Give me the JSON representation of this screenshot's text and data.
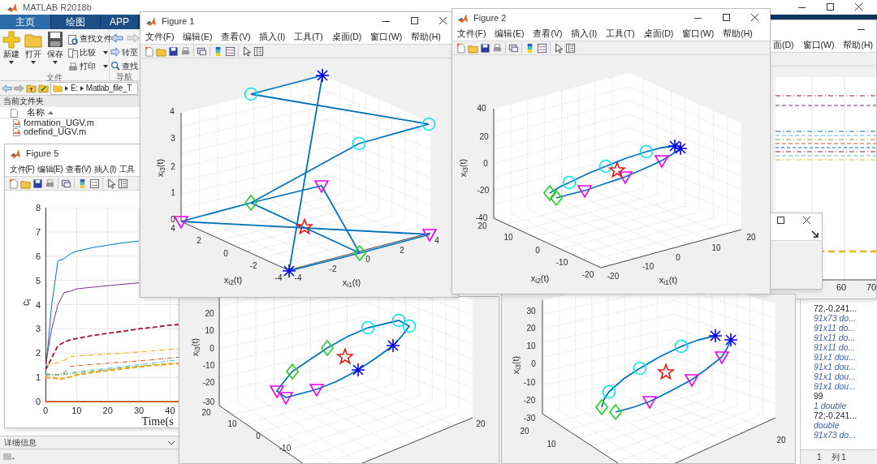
{
  "main_window": {
    "title": "MATLAB R2018b",
    "tabs": [
      {
        "label": "主页",
        "selected": true
      },
      {
        "label": "绘图",
        "selected": false
      },
      {
        "label": "APP",
        "selected": false
      }
    ],
    "toolstrip": {
      "big_buttons": [
        {
          "label": "新建",
          "kind": "new"
        },
        {
          "label": "打开",
          "kind": "open"
        },
        {
          "label": "保存",
          "kind": "save"
        }
      ],
      "small_buttons": [
        {
          "label": "查找文件",
          "kind": "find",
          "dropdown": false
        },
        {
          "label": "比较",
          "kind": "compare",
          "dropdown": true
        },
        {
          "label": "打印",
          "kind": "print",
          "dropdown": true
        }
      ],
      "nav_buttons": [
        {
          "label": "转至",
          "kind": "goto"
        },
        {
          "label": "查找",
          "kind": "search"
        }
      ],
      "sections": [
        "文件",
        "导航"
      ]
    },
    "address": [
      "E:",
      "Matlab_file_T"
    ],
    "current_folder": {
      "title": "当前文件夹",
      "column": "名称",
      "files": [
        "formation_UGV.m",
        "odefind_UGV.m"
      ]
    },
    "details": "详细信息",
    "workspace": [
      {
        "text": "72,-0.241...",
        "kind": "value"
      },
      {
        "text": "91x73 do...",
        "kind": "type"
      },
      {
        "text": "91x11 do...",
        "kind": "type"
      },
      {
        "text": "91x11 do...",
        "kind": "type"
      },
      {
        "text": "91x11 do...",
        "kind": "type"
      },
      {
        "text": "91x1 dou...",
        "kind": "type"
      },
      {
        "text": "91x1 dou...",
        "kind": "type"
      },
      {
        "text": "91x1 dou...",
        "kind": "type"
      },
      {
        "text": "91x1 dou...",
        "kind": "type"
      },
      {
        "text": "99",
        "kind": "value"
      },
      {
        "text": "1 double",
        "kind": "type"
      },
      {
        "text": "72;-0.241...",
        "kind": "value"
      },
      {
        "text": "double",
        "kind": "type"
      },
      {
        "text": "91x73 do...",
        "kind": "type"
      }
    ],
    "status": [
      "1",
      "列 1"
    ]
  },
  "figures": [
    {
      "kind": "perspective",
      "title": "Figure 1",
      "menu": [
        "文件(F)",
        "编辑(E)",
        "查看(V)",
        "插入(I)",
        "工具(T)",
        "桌面(D)",
        "窗口(W)",
        "帮助(H)"
      ],
      "axes": {
        "zlabel": "x$_{i3}$(t)",
        "ylabel": "x$_{i2}$(t)",
        "xlabel": "x$_{i1}$(t)",
        "zticks": [
          "4",
          "3",
          "2",
          "1",
          "0"
        ],
        "yticks": [
          "4",
          "2",
          "0",
          "-2",
          "-4"
        ],
        "xticks": [
          "-4",
          "-2",
          "0",
          "2",
          "4"
        ]
      }
    },
    {
      "kind": "perspective",
      "title": "Figure 2",
      "menu": [
        "文件(F)",
        "编辑(E)",
        "查看(V)",
        "插入(I)",
        "工具(T)",
        "桌面(D)",
        "窗口(W)",
        "帮助(H)"
      ],
      "axes": {
        "zlabel": "x$_{i3}$(t)",
        "ylabel": "x$_{i2}$(t)",
        "xlabel": "x$_{i1}$(t)",
        "zticks": [
          "40",
          "20",
          "0",
          "-20",
          "-40"
        ],
        "yticks": [
          "20",
          "10",
          "0",
          "-10",
          "-20"
        ],
        "xticks": [
          "-20",
          "-10",
          "0",
          "10",
          "20"
        ]
      }
    },
    {
      "kind": "lines",
      "menu": [
        "面(D)",
        "窗口(W)",
        "帮助(H)"
      ],
      "axes": {
        "xticks": [
          "60",
          "70"
        ]
      }
    },
    {
      "kind": "timeseries",
      "title": "Figure 5",
      "menu": [
        "文件(F)",
        "编辑(E)",
        "查看(V)",
        "插入(I)",
        "工具"
      ],
      "chart_data": {
        "type": "line",
        "xlabel": "Time(s",
        "ylabel": "c$_{i}$",
        "x": [
          0,
          2,
          4,
          6,
          8,
          10,
          15,
          20,
          25,
          30,
          35,
          40,
          43
        ],
        "xlim": [
          0,
          43
        ],
        "ylim": [
          0,
          8
        ],
        "grid": true,
        "xticks": [
          0,
          10,
          20,
          30,
          40
        ],
        "yticks": [
          0,
          1,
          2,
          3,
          4,
          5,
          6,
          7,
          8
        ],
        "series": [
          {
            "color": "#0072bd",
            "line_style": "solid",
            "values": [
              1.2,
              4,
              5.8,
              5.9,
              6.1,
              6.2,
              6.35,
              6.45,
              6.55,
              6.62,
              null,
              null,
              null
            ]
          },
          {
            "color": "#7e2f8e",
            "line_style": "solid",
            "values": [
              1.5,
              3,
              4,
              4.5,
              4.55,
              4.65,
              4.72,
              4.78,
              4.84,
              4.9,
              null,
              null,
              null
            ]
          },
          {
            "color": "#a2142f",
            "line_style": "dashed",
            "values": [
              1.3,
              1.8,
              2.3,
              2.45,
              2.55,
              2.6,
              2.72,
              2.82,
              2.9,
              3.0,
              3.07,
              3.15,
              3.18
            ]
          },
          {
            "color": "#edb120",
            "line_style": "dashdot",
            "values": [
              1.5,
              1.55,
              1.6,
              1.7,
              1.85,
              1.88,
              1.92,
              1.96,
              2.0,
              2.05,
              2.1,
              2.15,
              2.18
            ]
          },
          {
            "color": "#d95319",
            "line_style": "dashdot",
            "values": [
              1.1,
              1.1,
              1.1,
              1.2,
              1.45,
              1.48,
              1.53,
              1.58,
              1.63,
              1.68,
              1.73,
              1.8,
              1.83
            ]
          },
          {
            "color": "#4dbeee",
            "line_style": "dashdot",
            "values": [
              1.1,
              1.1,
              1.1,
              1.15,
              1.2,
              1.23,
              1.3,
              1.37,
              1.45,
              1.52,
              1.6,
              1.68,
              1.72
            ]
          },
          {
            "color": "#77ac30",
            "line_style": "dashdot",
            "values": [
              1.15,
              1.12,
              1.1,
              1.12,
              1.15,
              1.18,
              1.25,
              1.32,
              1.4,
              1.46,
              1.52,
              1.58,
              null
            ]
          },
          {
            "color": "#e8a820",
            "line_style": "dashed",
            "values": [
              1.0,
              0.98,
              0.95,
              0.95,
              1.02,
              1.1,
              1.2,
              1.28,
              1.36,
              1.43,
              1.5,
              1.55,
              1.58
            ]
          },
          {
            "color": "#d95319",
            "line_style": "solid",
            "values": [
              0,
              0,
              0,
              0,
              0,
              0,
              0,
              0,
              0,
              0,
              0,
              0,
              0
            ]
          }
        ]
      }
    },
    {
      "kind": "perspective",
      "axes": {
        "zlabel": "x$_{i3}$(t)",
        "zticks": [
          "20",
          "10",
          "0",
          "-10",
          "-20",
          "-30"
        ],
        "yticks": [
          "20",
          "10",
          "0",
          "-10"
        ],
        "xticks": [
          "20"
        ]
      }
    },
    {
      "kind": "perspective",
      "axes": {
        "zlabel": "x$_{i3}$(t)",
        "zticks": [
          "30",
          "20",
          "10",
          "0",
          "-10",
          "-20",
          "-30"
        ],
        "yticks": [
          "20",
          "10"
        ],
        "xticks": [
          "20"
        ]
      }
    }
  ]
}
